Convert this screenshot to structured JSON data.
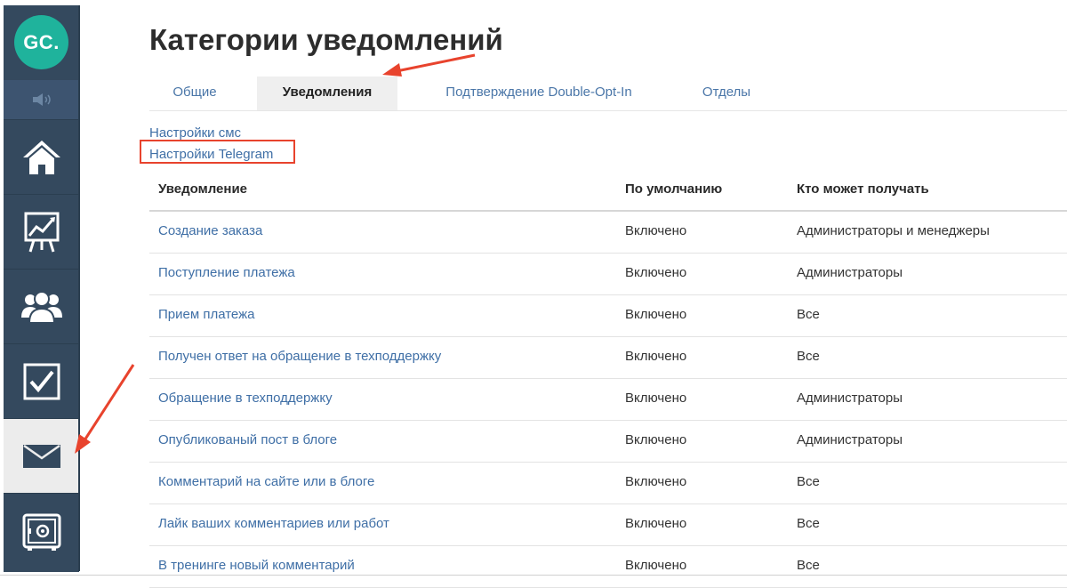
{
  "sidebar": {
    "logo_text": "GC.",
    "items": [
      {
        "name": "home-icon"
      },
      {
        "name": "chart-icon"
      },
      {
        "name": "users-icon"
      },
      {
        "name": "checkbox-icon"
      },
      {
        "name": "envelope-icon",
        "active": true
      },
      {
        "name": "safe-icon"
      }
    ]
  },
  "page": {
    "title": "Категории уведомлений"
  },
  "tabs": [
    {
      "label": "Общие"
    },
    {
      "label": "Уведомления",
      "active": true
    },
    {
      "label": "Подтверждение Double-Opt-In"
    },
    {
      "label": "Отделы"
    }
  ],
  "links": {
    "sms": "Настройки смс",
    "telegram": "Настройки Telegram"
  },
  "table": {
    "headers": [
      "Уведомление",
      "По умолчанию",
      "Кто может получать"
    ],
    "rows": [
      {
        "name": "Создание заказа",
        "default": "Включено",
        "who": "Администраторы и менеджеры"
      },
      {
        "name": "Поступление платежа",
        "default": "Включено",
        "who": "Администраторы"
      },
      {
        "name": "Прием платежа",
        "default": "Включено",
        "who": "Все"
      },
      {
        "name": "Получен ответ на обращение в техподдержку",
        "default": "Включено",
        "who": "Все"
      },
      {
        "name": "Обращение в техподдержку",
        "default": "Включено",
        "who": "Администраторы"
      },
      {
        "name": "Опубликованый пост в блоге",
        "default": "Включено",
        "who": "Администраторы"
      },
      {
        "name": "Комментарий на сайте или в блоге",
        "default": "Включено",
        "who": "Все"
      },
      {
        "name": "Лайк ваших комментариев или работ",
        "default": "Включено",
        "who": "Все"
      },
      {
        "name": "В тренинге новый комментарий",
        "default": "Включено",
        "who": "Все"
      }
    ]
  },
  "colors": {
    "sidebar_bg": "#34495e",
    "logo_bg": "#1fb39c",
    "link": "#3f6fa6",
    "annotation_red": "#e8432d"
  }
}
